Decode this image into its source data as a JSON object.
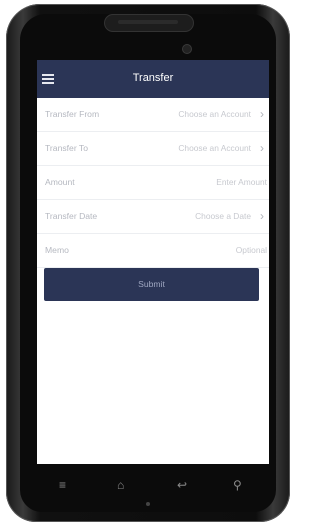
{
  "header": {
    "title": "Transfer"
  },
  "form": {
    "rows": [
      {
        "label": "Transfer From",
        "value": "Choose an Account",
        "chevron": "›"
      },
      {
        "label": "Transfer To",
        "value": "Choose an Account",
        "chevron": "›"
      },
      {
        "label": "Amount",
        "value": "Enter Amount"
      },
      {
        "label": "Transfer Date",
        "value": "Choose a Date",
        "chevron": "›"
      },
      {
        "label": "Memo",
        "value": "Optional"
      }
    ]
  },
  "submit": {
    "label": "Submit"
  },
  "navbar": {
    "menu_glyph": "≡",
    "home_glyph": "⌂",
    "back_glyph": "↩",
    "search_glyph": "⚲"
  },
  "colors": {
    "accent": "#2b3556",
    "background": "#ffffff"
  }
}
